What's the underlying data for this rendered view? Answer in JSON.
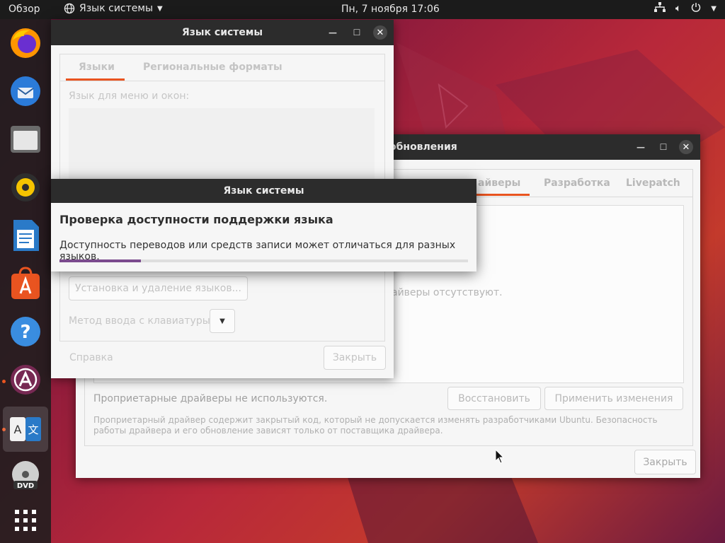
{
  "topbar": {
    "activities": "Обзор",
    "app_menu": "Язык системы",
    "clock": "Пн, 7 ноября  17:06"
  },
  "dock": {
    "items": [
      "firefox-icon",
      "thunderbird-icon",
      "files-icon",
      "rhythmbox-icon",
      "writer-icon",
      "software-center-icon",
      "help-icon",
      "software-updater-icon",
      "language-support-icon",
      "dvd-icon",
      "show-apps-icon"
    ]
  },
  "updates_window": {
    "title": "обновления",
    "tabs": [
      "айверы",
      "Разработка",
      "Livepatch"
    ],
    "drivers_missing_text": "айверы отсутствуют.",
    "status_text": "Проприетарные драйверы не используются.",
    "restore_button": "Восстановить",
    "apply_button": "Применить изменения",
    "note": "Проприетарный драйвер содержит закрытый код, который не допускается изменять разработчиками Ubuntu. Безопасность работы драйвера и его обновление зависят только от поставщика драйвера.",
    "close_button": "Закрыть"
  },
  "lang_window": {
    "title": "Язык системы",
    "tabs": [
      "Языки",
      "Региональные форматы"
    ],
    "menu_lang_label": "Язык для меню и окон:",
    "install_button": "Установка и удаление языков...",
    "input_method_label": "Метод ввода с клавиатуры:",
    "help_button": "Справка",
    "close_button": "Закрыть"
  },
  "dialog": {
    "title": "Язык системы",
    "heading": "Проверка доступности поддержки языка",
    "message": "Доступность переводов или средств записи может отличаться для разных языков.",
    "progress": 0.2
  },
  "colors": {
    "accent": "#e95420",
    "progress": "#7b4b8e",
    "titlebar": "#2c2c2c"
  }
}
